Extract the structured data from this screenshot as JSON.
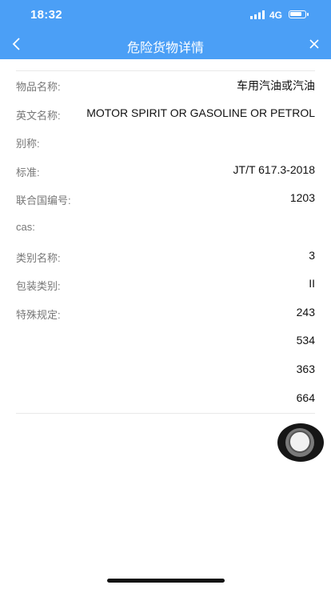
{
  "status": {
    "time": "18:32",
    "network": "4G",
    "icons": [
      "signal-icon",
      "battery-icon"
    ]
  },
  "nav": {
    "title": "危险货物详情",
    "back_icon": "chevron-left-icon",
    "close_icon": "close-icon"
  },
  "colors": {
    "header": "#4b9ff6"
  },
  "fields": [
    {
      "label": "物品名称:",
      "value": "车用汽油或汽油"
    },
    {
      "label": "英文名称:",
      "value": "MOTOR SPIRIT OR GASOLINE OR PETROL"
    },
    {
      "label": "别称:",
      "value": ""
    },
    {
      "label": "标准:",
      "value": "JT/T 617.3-2018"
    },
    {
      "label": "联合国编号:",
      "value": "1203"
    },
    {
      "label": "cas:",
      "value": ""
    },
    {
      "label": "类别名称:",
      "value": "3"
    },
    {
      "label": "包装类别:",
      "value": "II"
    },
    {
      "label": "特殊规定:",
      "value": "243"
    }
  ],
  "special_provisions_extra": [
    "534",
    "363",
    "664"
  ]
}
